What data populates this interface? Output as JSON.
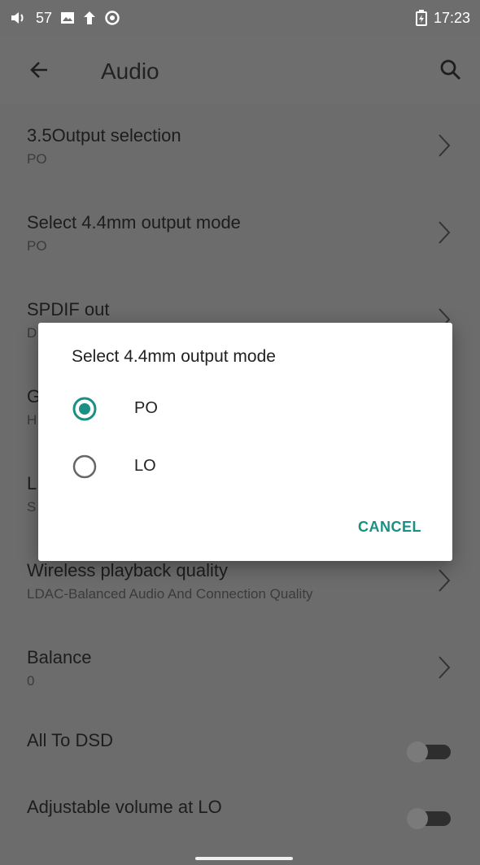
{
  "status_bar": {
    "volume_level": "57",
    "time": "17:23",
    "icons": [
      "volume-icon",
      "image-icon",
      "upload-icon",
      "sync-icon",
      "battery-charging-icon"
    ]
  },
  "app_bar": {
    "title": "Audio",
    "icons": [
      "back-arrow-icon",
      "search-icon"
    ]
  },
  "settings": {
    "items": [
      {
        "title": "3.5Output selection",
        "subtitle": "PO"
      },
      {
        "title": "Select 4.4mm output mode",
        "subtitle": "PO"
      },
      {
        "title": "SPDIF out",
        "subtitle": "D"
      },
      {
        "title": "G",
        "subtitle": "H"
      },
      {
        "title": "L",
        "subtitle": "S"
      },
      {
        "title": "Wireless playback quality",
        "subtitle": "LDAC-Balanced Audio And Connection Quality"
      },
      {
        "title": "Balance",
        "subtitle": "0"
      },
      {
        "title": "All To DSD",
        "toggle": false
      },
      {
        "title": "Adjustable volume at LO",
        "toggle": false
      }
    ]
  },
  "dialog": {
    "title": "Select 4.4mm output mode",
    "options": [
      {
        "label": "PO",
        "selected": true
      },
      {
        "label": "LO",
        "selected": false
      }
    ],
    "cancel_label": "CANCEL",
    "accent_color": "#1a8f83"
  }
}
